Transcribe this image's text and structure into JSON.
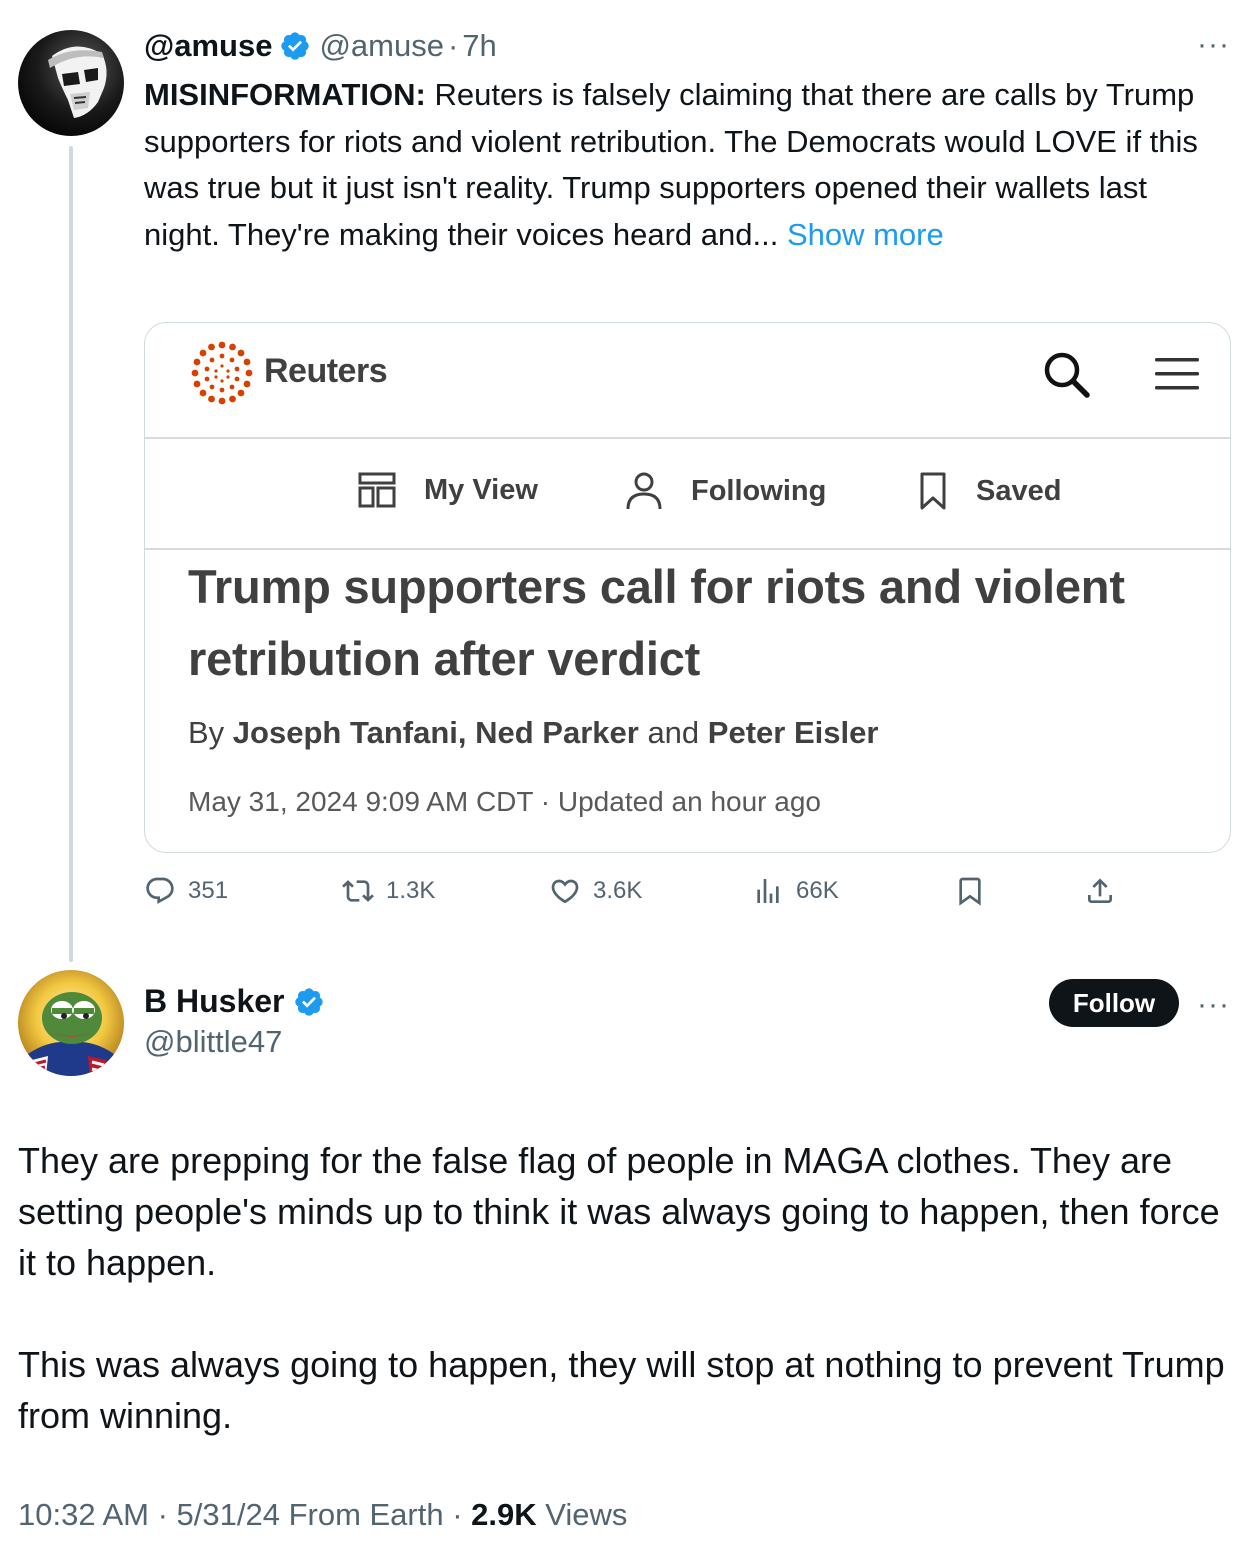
{
  "parent": {
    "name": "@amuse",
    "handle": "@amuse",
    "separator": "·",
    "time": "7h",
    "more": "···",
    "text_lead": "MISINFORMATION:",
    "text_body": " Reuters is falsely claiming that there are calls by Trump supporters for riots and violent retribution. The Democrats would LOVE if this was true but it just isn't reality. Trump supporters opened their wallets last night. They're making their voices heard and...",
    "show_more": "Show more"
  },
  "card": {
    "brand": "Reuters",
    "nav": {
      "my_view": "My View",
      "following": "Following",
      "saved": "Saved"
    },
    "title": "Trump supporters call for riots and violent retribution after verdict",
    "byline": {
      "by": "By ",
      "author1": "Joseph Tanfani",
      "sep1": ", ",
      "author2": "Ned Parker",
      "and": " and ",
      "author3": "Peter Eisler"
    },
    "date": "May 31, 2024 9:09 AM CDT · Updated an hour ago"
  },
  "actions": {
    "replies": "351",
    "reposts": "1.3K",
    "likes": "3.6K",
    "views": "66K"
  },
  "reply": {
    "name": "B Husker",
    "handle": "@blittle47",
    "follow_label": "Follow",
    "more": "···",
    "paragraph1": "They are prepping for the false flag of people in MAGA clothes. They are setting people's minds up to think it was always going to happen, then force it to happen.",
    "paragraph2": "This was always going to happen, they will stop at nothing to prevent Trump from winning.",
    "meta_prefix": "10:32 AM · 5/31/24 From Earth · ",
    "views_count": "2.9K",
    "views_label": " Views"
  },
  "colors": {
    "verified": "#1d9bf0",
    "link": "#1d9bf0",
    "secondary_text": "#536471",
    "reuters_orange": "#d64000"
  }
}
